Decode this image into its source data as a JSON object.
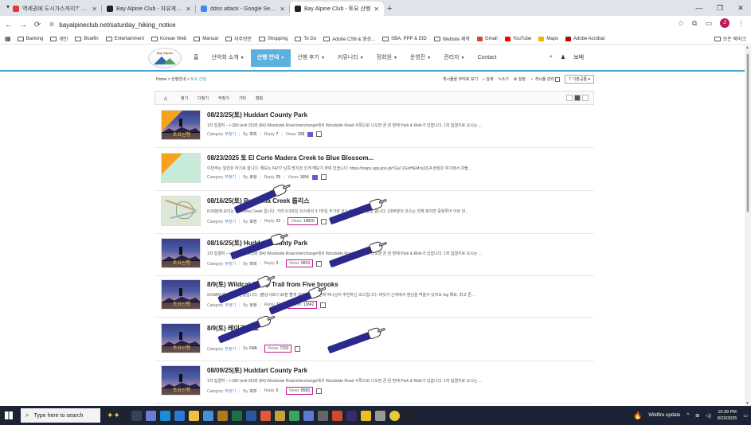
{
  "browser": {
    "tabs": [
      {
        "label": "역세권에 도시가스까지?' 수도",
        "fav_color": "#e53935",
        "active": false
      },
      {
        "label": "Bay Alpine Club - 자유게시판",
        "fav_color": "#222222",
        "active": false
      },
      {
        "label": "ddos attack - Google Search",
        "fav_color": "#4285f4",
        "active": false
      },
      {
        "label": "Bay Alpine Club - 토요 산행",
        "fav_color": "#222222",
        "active": true
      }
    ],
    "url": "bayalpineclub.net/saturday_hiking_notice",
    "bookmarks": [
      "Banking",
      "개인",
      "Bluefin",
      "Entertainment",
      "Korean Web",
      "Manual",
      "자주방문",
      "Shopping",
      "To Do",
      "Adobe CS6 & 영상...",
      "SBA, PPP & EID",
      "Website 제작",
      "Gmail",
      "YouTube",
      "Maps",
      "Adobe Acrobat"
    ],
    "bookmarks_right": "모든 북마크",
    "profile_initial": "J"
  },
  "site": {
    "logo_text": "Bay Alpine",
    "menu": [
      {
        "label": "홈",
        "caret": false,
        "active": false
      },
      {
        "label": "산악회 소개",
        "caret": true,
        "active": false
      },
      {
        "label": "산행 안내",
        "caret": true,
        "active": true
      },
      {
        "label": "산행 후기",
        "caret": true,
        "active": false
      },
      {
        "label": "커뮤니티",
        "caret": true,
        "active": false
      },
      {
        "label": "정회원",
        "caret": true,
        "active": false
      },
      {
        "label": "운영진",
        "caret": true,
        "active": false
      },
      {
        "label": "관리자",
        "caret": true,
        "active": false
      },
      {
        "label": "Contact",
        "caret": false,
        "active": false
      }
    ],
    "search_icon": "search-icon",
    "user_label": "보배"
  },
  "board": {
    "breadcrumb": [
      "Home",
      "산행안내",
      "토요 산행"
    ],
    "tools": {
      "read_all": "게시물을 부여로 보기",
      "search": "검색",
      "write": "쓰기",
      "settings": "설정",
      "admin": "게시물 관리",
      "sort": "기본공통"
    },
    "categories": [
      "정기",
      "다정기",
      "부정기",
      "기타",
      "캠핑"
    ],
    "posts": [
      {
        "title": "08/23/25(토) Huddart County Park",
        "excerpt": "1차 집결지 – I-280 (exit 25)와 (84) Woodside Road interchange에서 Woodside Road 서쪽으로 나오면 곧 왼 편에 Park & Ride가 있습니다. 1차 집결지로 오시는 ...",
        "category": "부정기",
        "author": "피피",
        "reply": "7",
        "views": "258",
        "thumb": "banner",
        "has_image_icon": true,
        "views_highlight": false
      },
      {
        "title": "08/23/2025 토 El Corte Madera Creek to Blue Blossom...",
        "excerpt": "이번주는 일반은 하기로 합니다. 해보는 64/77 남쪽 방지한 인게 해보기 하며 있습니다. https://maps.app.goo.gl/YGy7JGsfHEMcsZjCA 현장은 여기에서 차들...",
        "category": "부정기",
        "author": "호현",
        "reply": "29",
        "views": "1654",
        "thumb": "green",
        "has_image_icon": true,
        "views_highlight": false
      },
      {
        "title": "08/16/25(토) Purisima Creek 룹리스",
        "excerpt": "8:30분에 모이는 Purisima Creek 입니다. 거리 9.3마일 코스에서 3.7마일 추가된 코스로 총 13마일을 합니다. (대부분의 코스는 전체 펴지면 중장루어 아르 언...",
        "category": "부정기",
        "author": "호현",
        "reply": "22",
        "views": "14820",
        "thumb": "map",
        "has_image_icon": false,
        "views_highlight": true
      },
      {
        "title": "08/16/25(토) Huddart County Park",
        "excerpt": "1차 집결지 – I-280 (exit 25)와 (84) Woodside Road interchange에서 Woodside Road 서쪽으로 나오면 곧 왼 편에 Park & Ride가 있습니다. 1차 집결지로 오시는 ...",
        "category": "부정기",
        "author": "피피",
        "reply": "3",
        "views": "9819",
        "thumb": "banner",
        "has_image_icon": false,
        "views_highlight": true
      },
      {
        "title": "8/9(토) Wildcat Camp Trail from Five brooks",
        "excerpt": "9:00AM 에 모이는 산행입니다. (평상시보다 30분 빨게 모여요) 오래전에 여니님이 추천하신 코스입니다. 바닷가 근처에서 점심을 먹을수 있어요 fog 해보, 최고 존...",
        "category": "부정기",
        "author": "호현",
        "reply": "32",
        "views": "11842",
        "thumb": "banner",
        "has_image_icon": false,
        "views_highlight": true
      },
      {
        "title": "8/9(토) 레이크 타호",
        "excerpt": "",
        "category": "부정기",
        "author": "FAB",
        "reply": "",
        "views": "7292",
        "thumb": "banner",
        "has_image_icon": false,
        "views_highlight": true
      },
      {
        "title": "08/09/25(토) Huddart County Park",
        "excerpt": "1차 집결지 – I-280 (exit 25)와 (84) Woodside Road interchange에서 Woodside Road 서쪽으로 나오면 곧 왼 편에 Park & Ride가 있습니다. 1차 집결지로 오시는 ...",
        "category": "부정기",
        "author": "피피",
        "reply": "5",
        "views": "8583",
        "thumb": "banner",
        "has_image_icon": false,
        "views_highlight": true
      }
    ],
    "meta_labels": {
      "category": "Category",
      "by": "By",
      "reply": "Reply",
      "views": "Views"
    },
    "thumb_banner_text": "토요산행"
  },
  "taskbar": {
    "search_placeholder": "Type here to search",
    "weather": "Wildfire update",
    "time": "10:39 PM",
    "date": "8/23/2025"
  }
}
